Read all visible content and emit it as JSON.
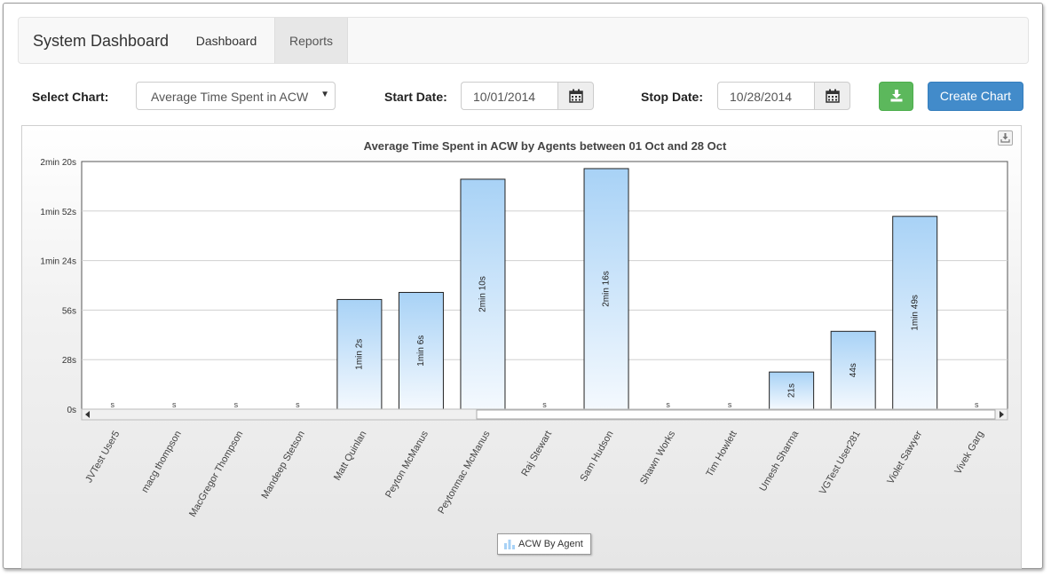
{
  "navbar": {
    "brand": "System Dashboard",
    "items": [
      {
        "label": "Dashboard"
      },
      {
        "label": "Reports",
        "active": true
      }
    ]
  },
  "controls": {
    "select_chart_label": "Select Chart:",
    "select_chart_value": "Average Time Spent in ACW",
    "start_date_label": "Start Date:",
    "start_date_value": "10/01/2014",
    "stop_date_label": "Stop Date:",
    "stop_date_value": "10/28/2014",
    "download_icon": "download-icon",
    "calendar_icon": "calendar-icon",
    "create_chart_label": "Create Chart",
    "colors": {
      "download": "#5cb85c",
      "create": "#428bca"
    }
  },
  "chart_data": {
    "type": "bar",
    "title": "Average Time Spent in ACW by Agents between 01 Oct and 28 Oct",
    "categories": [
      "JVTest User5",
      "macg thompson",
      "MacGregor Thompson",
      "Mandeep Stetson",
      "Matt Quinlan",
      "Peyton McManus",
      "Peytonmac McManus",
      "Raj Stewart",
      "Sam Hudson",
      "Shawn Works",
      "Tim Howlett",
      "Umesh Sharma",
      "VGTest User281",
      "Violet Sawyer",
      "Vivek Garg"
    ],
    "series": [
      {
        "name": "ACW By Agent",
        "values": [
          0,
          0,
          0,
          0,
          62,
          66,
          130,
          0,
          136,
          0,
          0,
          21,
          44,
          109,
          0
        ],
        "labels": [
          "s",
          "s",
          "s",
          "s",
          "1min 2s",
          "1min 6s",
          "2min 10s",
          "s",
          "2min 16s",
          "s",
          "s",
          "21s",
          "44s",
          "1min 49s",
          "s"
        ]
      }
    ],
    "ylim": [
      0,
      140
    ],
    "yticks": [
      0,
      28,
      56,
      84,
      112,
      140
    ],
    "ytick_labels": [
      "0s",
      "28s",
      "56s",
      "1min 24s",
      "1min 52s",
      "2min 20s"
    ],
    "grid": true,
    "legend": "bottom-center",
    "bar_color": "#a8d2f6"
  }
}
